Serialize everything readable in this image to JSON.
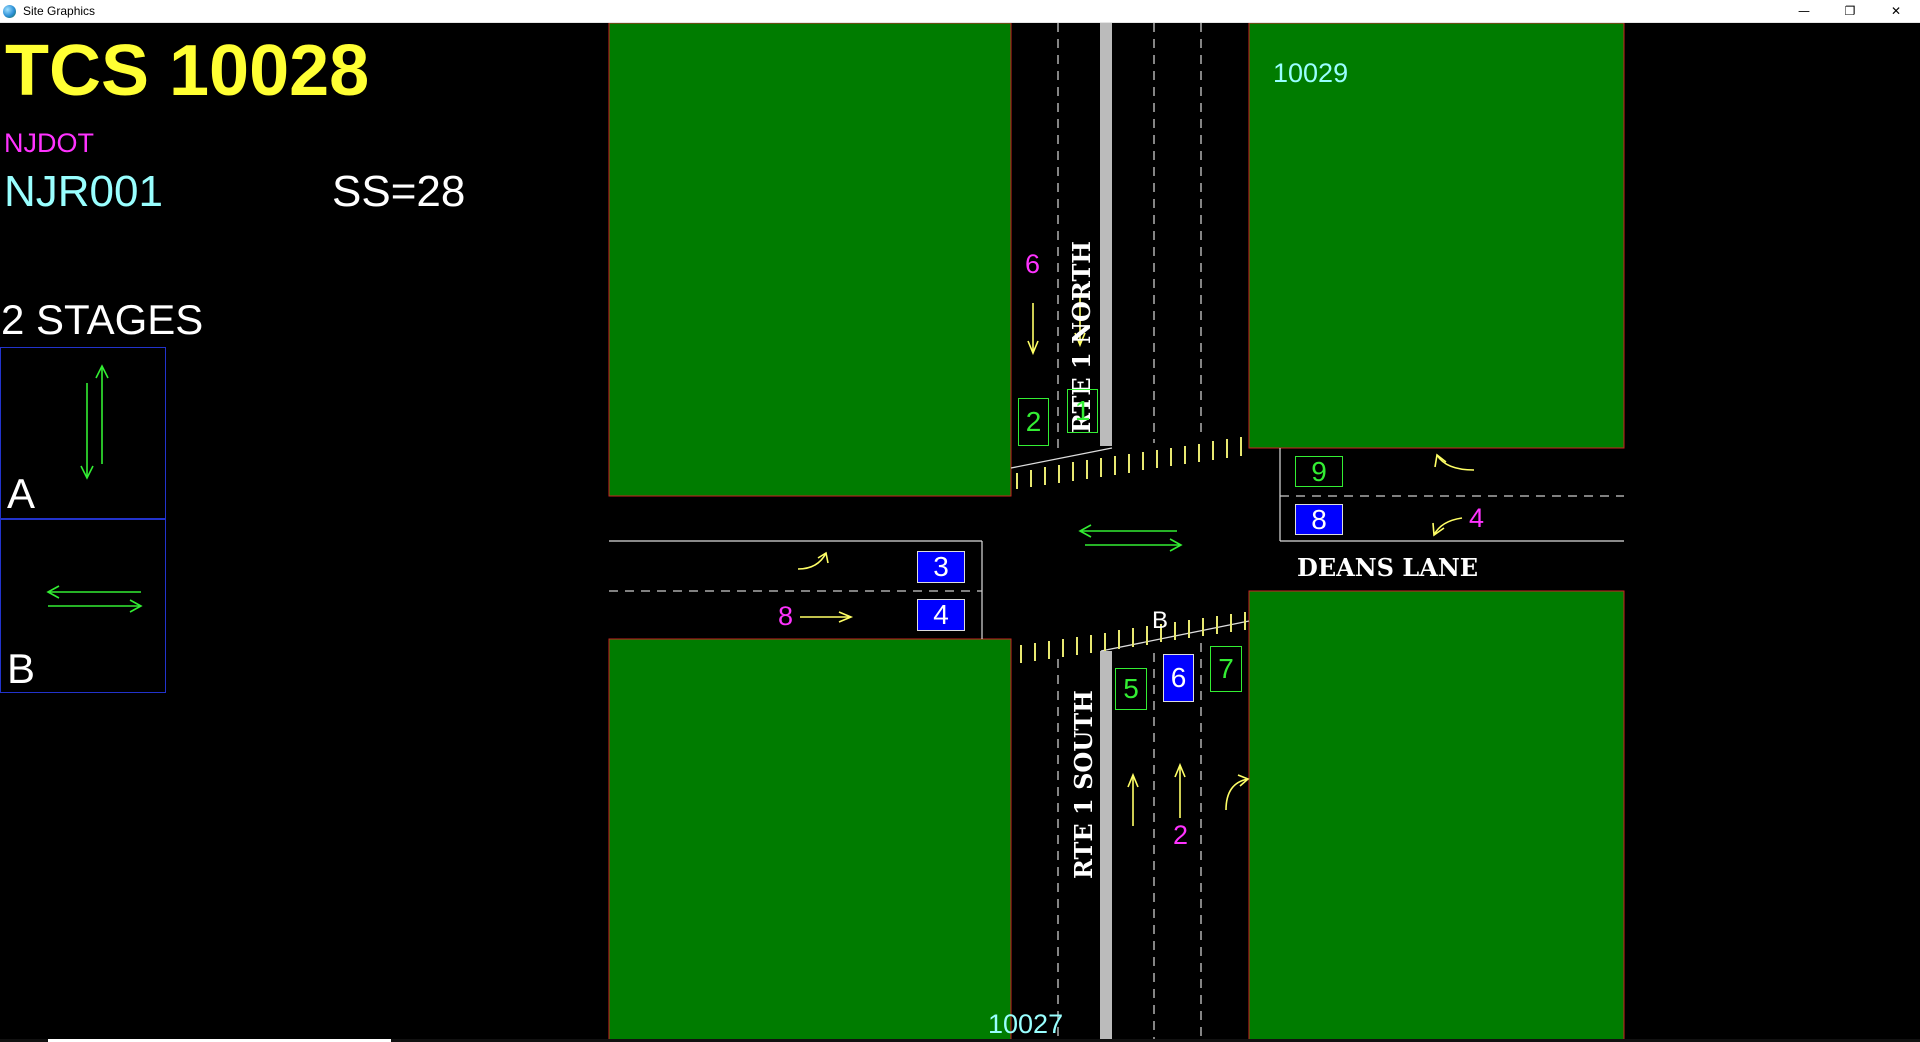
{
  "window": {
    "title": "Site Graphics",
    "minimize_glyph": "—",
    "restore_glyph": "❐",
    "close_glyph": "✕"
  },
  "header": {
    "tcs": "TCS 10028",
    "agency": "NJDOT",
    "system_id": "NJR001",
    "ss": "SS=28",
    "stages_label": "2 STAGES"
  },
  "stages": [
    {
      "letter": "A"
    },
    {
      "letter": "B"
    }
  ],
  "roads": {
    "north": "RTE 1 NORTH",
    "south": "RTE 1 SOUTH",
    "east": "DEANS LANE"
  },
  "site_ids": {
    "northeast": "10029",
    "south": "10027"
  },
  "detectors": {
    "north_1": "1",
    "north_2": "2",
    "east_9": "9",
    "east_8": "8",
    "west_3": "3",
    "west_4": "4",
    "south_5": "5",
    "south_6": "6",
    "south_7": "7"
  },
  "phases": {
    "north": "6",
    "east": "4",
    "west": "8",
    "south": "2"
  },
  "crossing_label": "B",
  "colors": {
    "background": "#000000",
    "grass": "#007c00",
    "tcs_text": "#ffff33",
    "agency": "#ff33ff",
    "system_id": "#99ffff",
    "detector_green": "#33ee33",
    "detector_blue": "#0000ff",
    "phase_magenta": "#ff33ff",
    "movement_arrows": "#ffff66",
    "stage_arrows": "#33ee33"
  }
}
